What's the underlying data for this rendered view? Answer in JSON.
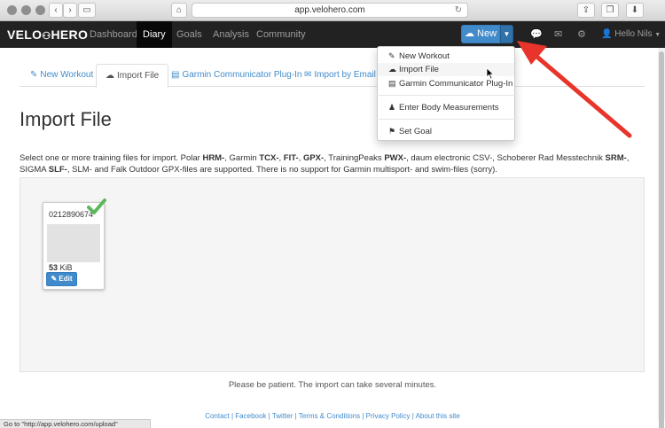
{
  "browser": {
    "url": "app.velohero.com",
    "back_icon": "chevron-left-icon",
    "forward_icon": "chevron-right-icon"
  },
  "navbar": {
    "brand_left": "VELO",
    "brand_right": "HERO",
    "links": [
      "Dashboard",
      "Diary",
      "Goals",
      "Analysis",
      "Community"
    ],
    "active": "Diary",
    "new_label": "New",
    "user_label": "Hello Nils"
  },
  "dropdown": {
    "items": [
      "New Workout",
      "Import File",
      "Garmin Communicator Plug-In",
      "Enter Body Measurements",
      "Set Goal"
    ],
    "hovered": "Import File"
  },
  "tabs": [
    "New Workout",
    "Import File",
    "Garmin Communicator Plug-In",
    "Import by Email"
  ],
  "active_tab": "Import File",
  "page": {
    "title": "Import File",
    "description_parts": [
      "Select one or more training files for import. Polar ",
      "HRM-",
      ", Garmin ",
      "TCX-",
      ", ",
      "FIT-",
      ", ",
      "GPX-",
      ", TrainingPeaks ",
      "PWX-",
      ", daum electronic CSV-, Schoberer Rad Messtechnik ",
      "SRM-",
      ", SIGMA ",
      "SLF-",
      ", SLM- and Falk Outdoor GPX-files are supported. There is no support for Garmin multisport- and swim-files (sorry)."
    ],
    "file": {
      "name": "0212890674",
      "size_value": "53",
      "size_unit": "KiB",
      "edit_label": "Edit"
    },
    "patience": "Please be patient. The import can take several minutes."
  },
  "footer": {
    "links": [
      "Contact",
      "Facebook",
      "Twitter",
      "Terms & Conditions",
      "Privacy Policy",
      "About this site"
    ]
  },
  "status_bar": "Go to \"http://app.velohero.com/upload\"",
  "colors": {
    "navbar_bg": "#222222",
    "primary": "#428bca",
    "check_green": "#5cb85c",
    "annotation_arrow": "#e8342a"
  }
}
